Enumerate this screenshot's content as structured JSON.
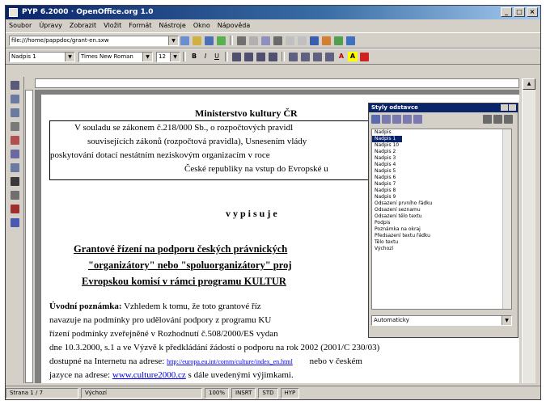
{
  "window": {
    "title": "PYP 6.2000 · OpenOffice.org 1.0"
  },
  "menu": [
    "Soubor",
    "Úpravy",
    "Zobrazit",
    "Vložit",
    "Formát",
    "Nástroje",
    "Okno",
    "Nápověda"
  ],
  "toolbar": {
    "file_path": "file:///home/pappdoc/grant-en.sxw",
    "paragraph_style": "Nadpis 1",
    "font_name": "Times New Roman",
    "font_size": "12"
  },
  "document": {
    "heading": "Ministerstvo kultury ČR",
    "box_lines": [
      "V souladu se zákonem č.218/000 Sb., o rozpočtových pravidl",
      "souvisejících zákonů (rozpočtová pravidla), Usnesením vlády",
      "poskytování dotací nestátním neziskovým organizacím v roce",
      "České republiky na vstup do Evropské u"
    ],
    "vypisuje": "v y p i s u j e",
    "grant_lines": [
      "Grantové řízení na podporu českých právnických",
      "\"organizátory\" nebo \"spoluorganizátory\" proj",
      "Evropskou komisí v rámci programu KULTUR"
    ],
    "note_label": "Úvodní poznámka:",
    "body_lines": [
      "Vzhledem k tomu, že toto grantové říz",
      "navazuje na podmínky pro udělování podpory z programu KU",
      "řízení podmínky zveřejněné v Rozhodnutí č.508/2000/ES vydan",
      "dne 10.3.2000, s.1 a ve Výzvě k předkládání žádostí o podporu na rok 2002 (2001/C 230/03)",
      "dostupné na Internetu na adrese:",
      "jazyce na adrese:"
    ],
    "link1": "http://europa.eu.int/comm/culture/index_en.html",
    "link1_tail": "nebo v českém",
    "link2": "www.culture2000.cz",
    "link2_tail": "s dále uvedenými výjimkami."
  },
  "stylist": {
    "title": "Styly odstavce",
    "items": [
      "Nadpis",
      "Nadpis 1",
      "Nadpis 10",
      "Nadpis 2",
      "Nadpis 3",
      "Nadpis 4",
      "Nadpis 5",
      "Nadpis 6",
      "Nadpis 7",
      "Nadpis 8",
      "Nadpis 9",
      "Odsazení prvního řádku",
      "Odsazení seznamu",
      "Odsazení tělo textu",
      "Podpis",
      "Poznámka na okraj",
      "Předsazení textu řádku",
      "Tělo textu",
      "Výchozí"
    ],
    "selected_index": 1,
    "filter": "Automaticky"
  },
  "status": {
    "page": "Strana 1 / 7",
    "style": "Výchozí",
    "zoom": "100%",
    "mode1": "INSRT",
    "mode2": "STD",
    "mode3": "HYP"
  },
  "colors": {
    "title_bar": "#0a246a",
    "link": "#0000ee"
  }
}
